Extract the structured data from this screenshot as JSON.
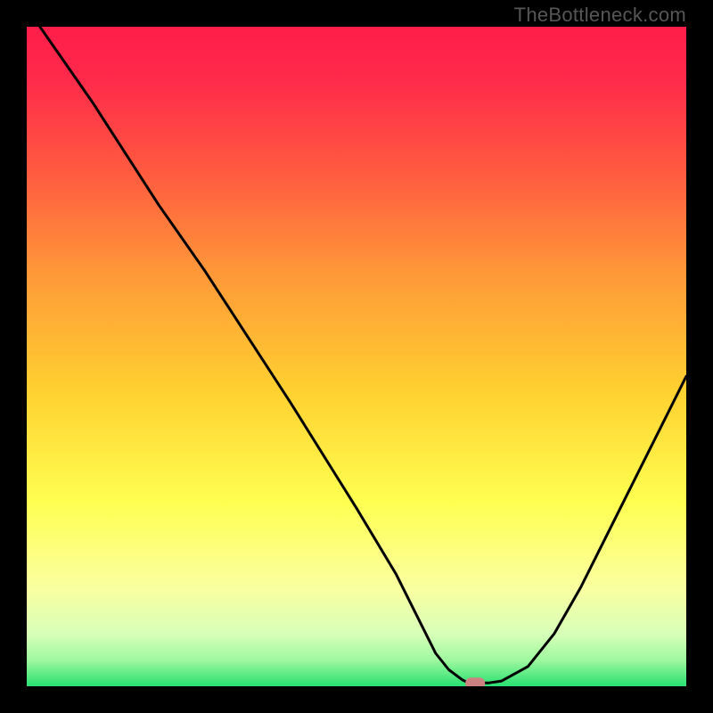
{
  "watermark": "TheBottleneck.com",
  "chart_data": {
    "type": "line",
    "title": "",
    "xlabel": "",
    "ylabel": "",
    "xlim": [
      0,
      100
    ],
    "ylim": [
      0,
      100
    ],
    "grid": false,
    "legend": false,
    "x": [
      2,
      10,
      20,
      27,
      40,
      50,
      56,
      60,
      62,
      64,
      66,
      67,
      68,
      70,
      72,
      76,
      80,
      84,
      88,
      92,
      96,
      100
    ],
    "values": [
      100,
      88.5,
      73,
      63,
      43,
      27,
      17,
      9,
      5,
      2.5,
      1,
      0.5,
      0.5,
      0.5,
      0.8,
      3,
      8,
      15,
      23,
      31,
      39,
      47
    ],
    "marker_x": 68,
    "marker_y": 0.5,
    "colors": {
      "line": "#000000",
      "gradient_top": "#ff2850",
      "gradient_mid1": "#ff8040",
      "gradient_mid2": "#ffd030",
      "gradient_mid3": "#ffff60",
      "gradient_mid4": "#e8ffb0",
      "gradient_bottom": "#30e070",
      "marker": "#cd8282",
      "frame": "#000000"
    }
  }
}
